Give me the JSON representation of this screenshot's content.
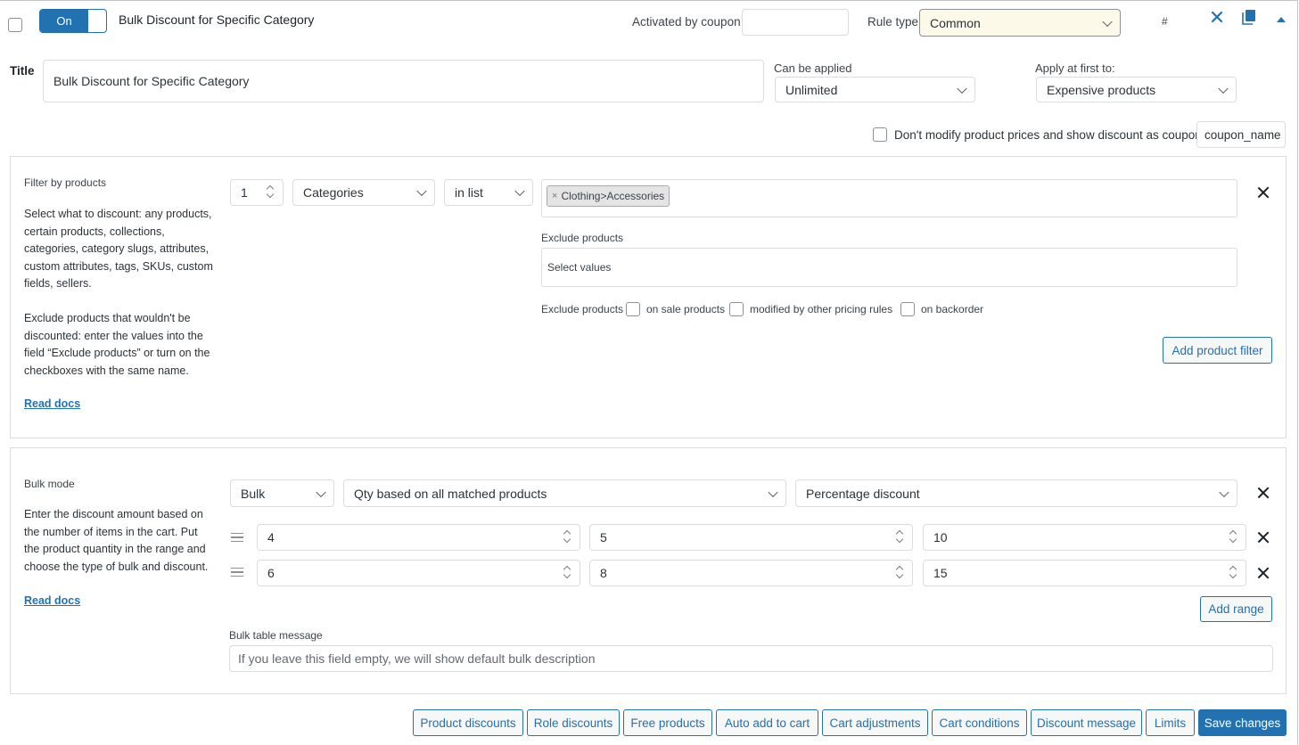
{
  "header": {
    "toggle_label": "On",
    "rule_title": "Bulk Discount for Specific Category",
    "activated_by_coupon_label": "Activated by coupon",
    "activated_by_coupon_value": "",
    "rule_type_label": "Rule type",
    "rule_type_value": "Common",
    "hash_label": "#"
  },
  "settings": {
    "title_label": "Title",
    "title_value": "Bulk Discount for Specific Category",
    "can_be_applied_label": "Can be applied",
    "can_be_applied_value": "Unlimited",
    "apply_first_label": "Apply at first to:",
    "apply_first_value": "Expensive products",
    "dont_modify_label": "Don't modify product prices and show discount as coupon",
    "coupon_name_value": "coupon_name"
  },
  "filter": {
    "heading": "Filter by products",
    "help_1": "Select what to discount: any products, certain products, collections, categories, category slugs, attributes, custom attributes, tags, SKUs, custom fields, sellers.",
    "help_2": "Exclude products that wouldn't be discounted: enter the values into the field “Exclude products” or turn on the checkboxes with the same name.",
    "read_docs": "Read docs",
    "qty_value": "1",
    "type_value": "Categories",
    "method_value": "in list",
    "tag_remove": "×",
    "tag_value": "Clothing>Accessories",
    "exclude_label": "Exclude products",
    "exclude_placeholder": "Select values",
    "exclude_checkbox_label": "Exclude products",
    "on_sale_label": "on sale products",
    "modified_label": "modified by other pricing rules",
    "backorder_label": "on backorder",
    "add_filter_button": "Add product filter"
  },
  "bulk": {
    "heading": "Bulk mode",
    "help": "Enter the discount amount based on the number of items in the cart. Put the product quantity in the range and choose the type of bulk and discount.",
    "read_docs": "Read docs",
    "mode_value": "Bulk",
    "qty_based_value": "Qty based on all matched products",
    "discount_type_value": "Percentage discount",
    "ranges": [
      {
        "from": "4",
        "to": "5",
        "value": "10"
      },
      {
        "from": "6",
        "to": "8",
        "value": "15"
      }
    ],
    "add_range_button": "Add range",
    "table_message_label": "Bulk table message",
    "table_message_placeholder": "If you leave this field empty, we will show default bulk description"
  },
  "footer": {
    "buttons": [
      "Product discounts",
      "Role discounts",
      "Free products",
      "Auto add to cart",
      "Cart adjustments",
      "Cart conditions",
      "Discount message",
      "Limits"
    ],
    "save_button": "Save changes"
  },
  "colors": {
    "accent": "#2271b1",
    "rule_type_bg": "#fcf9e8"
  }
}
